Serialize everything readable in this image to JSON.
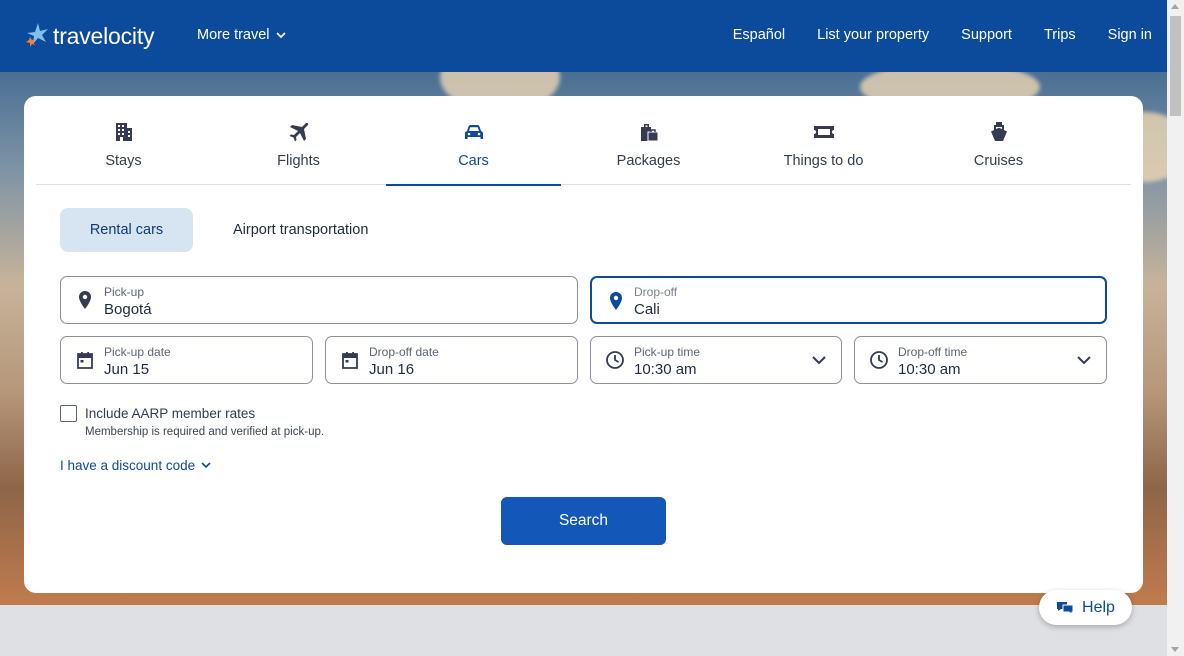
{
  "header": {
    "logo_text": "travelocity",
    "more_travel": "More travel",
    "nav": [
      "Español",
      "List your property",
      "Support",
      "Trips",
      "Sign in"
    ]
  },
  "tabs": [
    {
      "label": "Stays",
      "icon": "building-icon"
    },
    {
      "label": "Flights",
      "icon": "plane-icon"
    },
    {
      "label": "Cars",
      "icon": "car-icon",
      "active": true
    },
    {
      "label": "Packages",
      "icon": "luggage-icon"
    },
    {
      "label": "Things to do",
      "icon": "ticket-icon"
    },
    {
      "label": "Cruises",
      "icon": "ship-icon"
    }
  ],
  "subtabs": {
    "rental": "Rental cars",
    "airport": "Airport transportation"
  },
  "form": {
    "pickup": {
      "label": "Pick-up",
      "value": "Bogotá"
    },
    "dropoff": {
      "label": "Drop-off",
      "value": "Cali"
    },
    "pickup_date": {
      "label": "Pick-up date",
      "value": "Jun 15"
    },
    "dropoff_date": {
      "label": "Drop-off date",
      "value": "Jun 16"
    },
    "pickup_time": {
      "label": "Pick-up time",
      "value": "10:30 am"
    },
    "dropoff_time": {
      "label": "Drop-off time",
      "value": "10:30 am"
    },
    "aarp_label": "Include AARP member rates",
    "aarp_note": "Membership is required and verified at pick-up.",
    "discount_link": "I have a discount code",
    "search_label": "Search"
  },
  "help_label": "Help",
  "colors": {
    "brand": "#0c4a9c",
    "button": "#1357b8",
    "selected_subtab": "#d7e5f3"
  }
}
